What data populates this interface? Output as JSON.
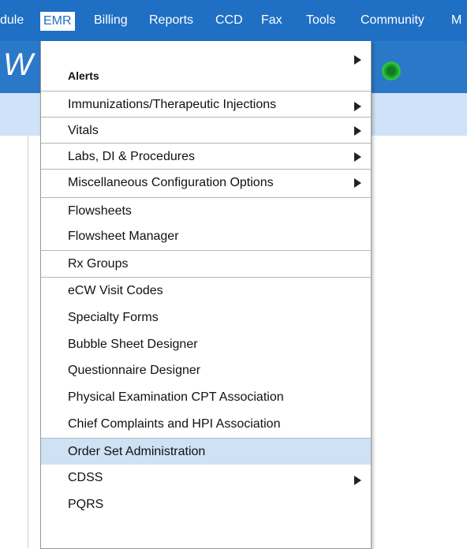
{
  "menubar": {
    "items": [
      "dule",
      "EMR",
      "Billing",
      "Reports",
      "CCD",
      "Fax",
      "Tools",
      "Community",
      "M"
    ]
  },
  "header": {
    "logo_text": "W"
  },
  "dropdown": {
    "items": [
      {
        "label": "Alerts",
        "submenu": true
      },
      {
        "label": "Immunizations/Therapeutic Injections",
        "submenu": true
      },
      {
        "label": "Vitals",
        "submenu": true
      },
      {
        "label": "Labs, DI & Procedures",
        "submenu": true
      },
      {
        "label": "Miscellaneous Configuration Options",
        "submenu": true
      },
      {
        "label": "Flowsheets",
        "submenu": false
      },
      {
        "label": "Flowsheet Manager",
        "submenu": false
      },
      {
        "label": "Rx Groups",
        "submenu": false
      },
      {
        "label": "eCW Visit Codes",
        "submenu": false
      },
      {
        "label": "Specialty Forms",
        "submenu": false
      },
      {
        "label": "Bubble Sheet Designer",
        "submenu": false
      },
      {
        "label": "Questionnaire Designer",
        "submenu": false
      },
      {
        "label": "Physical Examination CPT Association",
        "submenu": false
      },
      {
        "label": "Chief Complaints and HPI Association",
        "submenu": false
      },
      {
        "label": "Order Set Administration",
        "submenu": false
      },
      {
        "label": "CDSS",
        "submenu": true
      },
      {
        "label": "PQRS",
        "submenu": false
      }
    ]
  },
  "colors": {
    "menubar": "#1f6fc4",
    "highlight": "#cfe1f4",
    "status": "#1aa12f"
  }
}
